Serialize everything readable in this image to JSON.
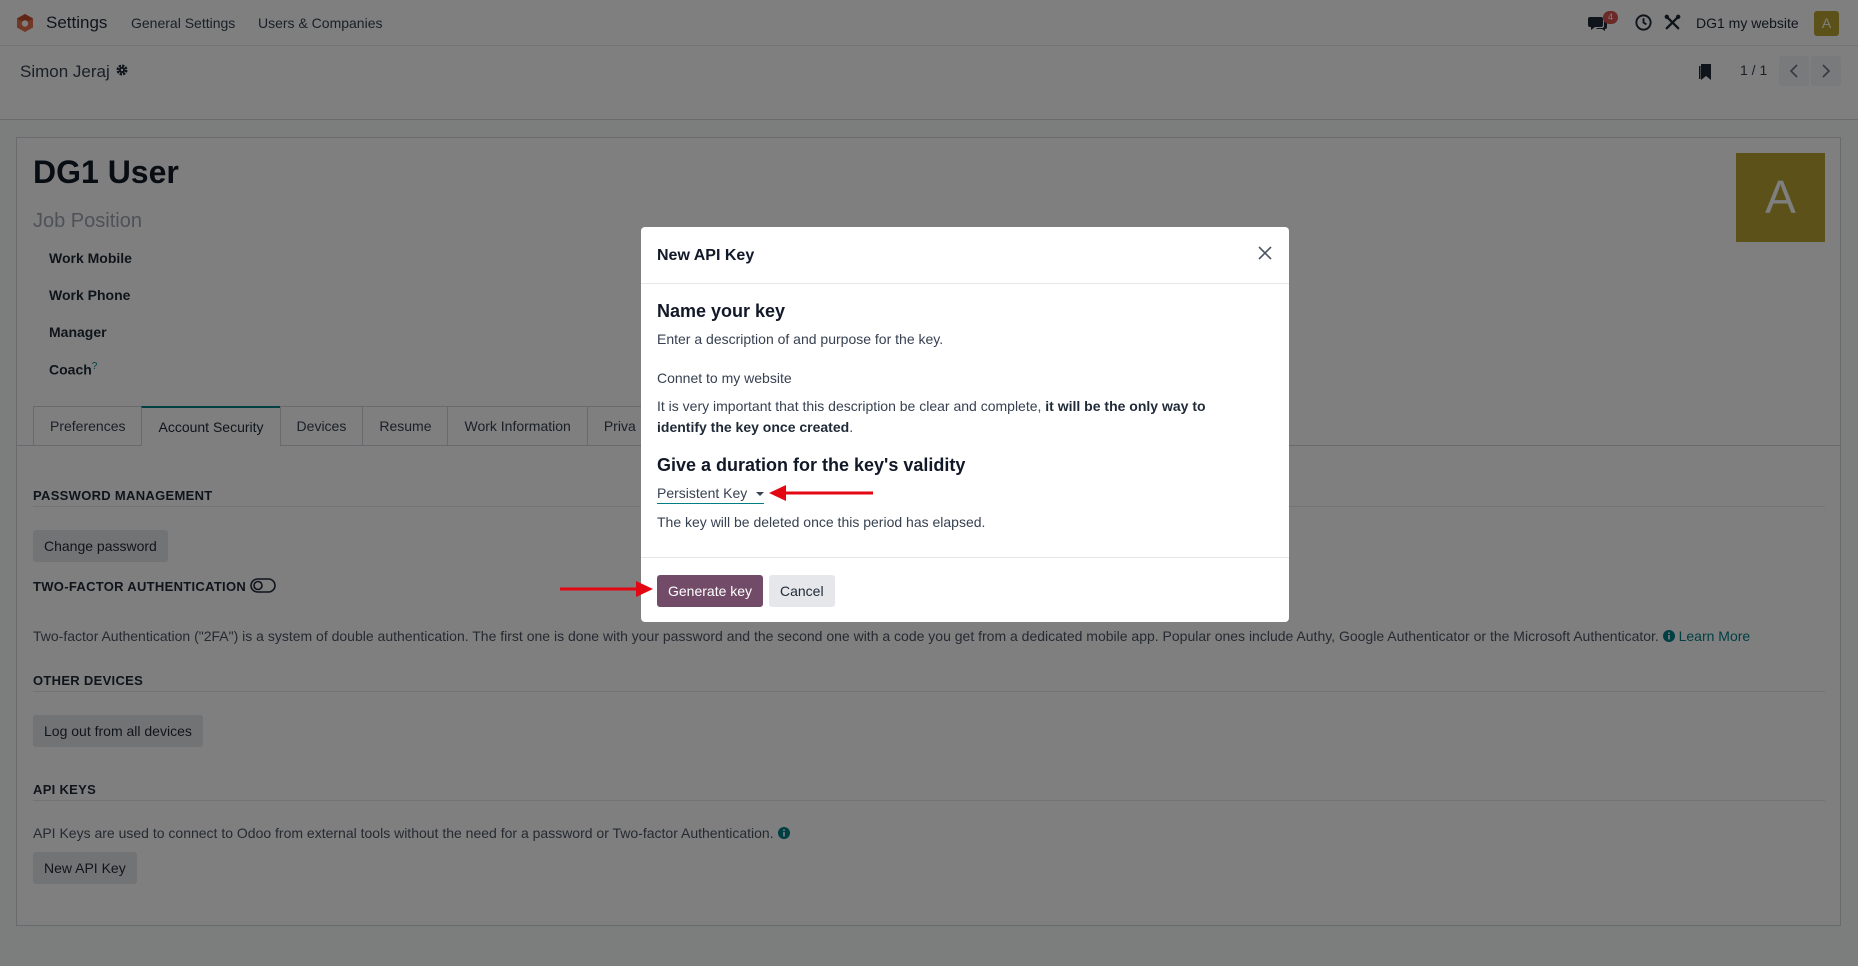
{
  "navbar": {
    "app_name": "Settings",
    "menu": [
      "General Settings",
      "Users & Companies"
    ],
    "chat_badge": "4",
    "company": "DG1 my website",
    "user_initial": "A"
  },
  "control_panel": {
    "breadcrumb": "Simon Jeraj",
    "pager": "1 / 1"
  },
  "form": {
    "name": "DG1 User",
    "job_position": "Job Position",
    "fields": [
      "Work Mobile",
      "Work Phone",
      "Manager",
      "Coach"
    ],
    "coach_tooltip_mark": "?",
    "avatar_initial": "A",
    "tabs": [
      "Preferences",
      "Account Security",
      "Devices",
      "Resume",
      "Work Information",
      "Priva"
    ],
    "active_tab": "Account Security",
    "password_section": "PASSWORD MANAGEMENT",
    "change_password": "Change password",
    "twofa_section": "TWO-FACTOR AUTHENTICATION",
    "twofa_help": "Two-factor Authentication (\"2FA\") is a system of double authentication. The first one is done with your password and the second one with a code you get from a dedicated mobile app. Popular ones include Authy, Google Authenticator or the Microsoft Authenticator.",
    "learn_more": "Learn More",
    "devices_section": "OTHER DEVICES",
    "logout_all": "Log out from all devices",
    "api_section": "API KEYS",
    "api_help": "API Keys are used to connect to Odoo from external tools without the need for a password or Two-factor Authentication.",
    "new_api_key": "New API Key"
  },
  "dialog": {
    "title": "New API Key",
    "name_heading": "Name your key",
    "name_help": "Enter a description of and purpose for the key.",
    "key_value": "Connet to my website",
    "warning_plain": "It is very important that this description be clear and complete, ",
    "warning_bold": "it will be the only way to identify the key once created",
    "warning_end": ".",
    "duration_heading": "Give a duration for the key's validity",
    "duration_value": "Persistent Key",
    "duration_help": "The key will be deleted once this period has elapsed.",
    "generate_button": "Generate key",
    "cancel_button": "Cancel"
  },
  "colors": {
    "primary": "#714b67",
    "accent": "#017e84",
    "avatar": "#b8a332",
    "annotation_arrow": "#e30613"
  }
}
